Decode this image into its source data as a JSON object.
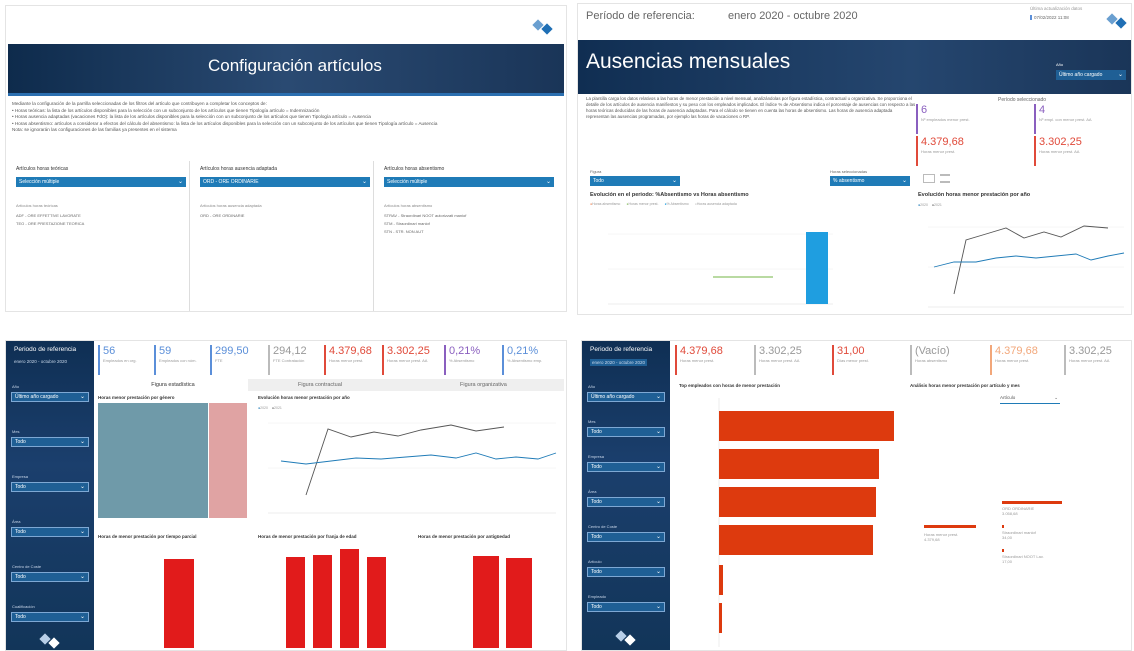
{
  "tl": {
    "title": "Configuración artículos",
    "desc": [
      "Mediante la configuración de la parrilla seleccionadas de los filtros del artículo que contribuyen a completar los conceptos de:",
      "• Horas teóricas: la lista de los artículos disponibles para la selección con un subconjunto de los artículos que tienen Tipología artículo = Indemnización",
      "• Horas ausencia adaptadas (vacaciones FdO): la lista de los artículos disponibles para la selección con un subconjunto de los artículos que tienen Tipología artículo = Ausencia",
      "• Horas absentismo: artículos a considerar a efectos del cálculo del absentismo: la lista de los artículos disponibles para la selección con un subconjunto de los artículos que tienen Tipología artículo = Ausencia",
      "Nota: se ignorarán las configuraciones de las familias ya presentes en el sistema"
    ],
    "cols": [
      {
        "head": "Artículos horas teóricas",
        "dd": "Selección múltiple",
        "sub": "Artículos horas teóricas",
        "items": [
          "ADF - ORE EFFETTIVE LAVORATE",
          "TEO - ORE PRESTAZIONE TEORICA"
        ]
      },
      {
        "head": "Artículos horas ausencia adaptada",
        "dd": "ORD - ORE ORDINARIE",
        "sub": "Artículos horas ausencia adaptada",
        "items": [
          "ORD - ORE ORDINARIE"
        ]
      },
      {
        "head": "Artículos horas absentismo",
        "dd": "Selección múltiple",
        "sub": "Artículos horas absentismo",
        "items": [
          "STRAV - Straordinari NOOT autorizzati maniof",
          "STM - Straordinari maniof",
          "STN - STR. NON AUT"
        ]
      }
    ]
  },
  "tr": {
    "ref_label": "Período de referencia:",
    "ref_value": "enero 2020 - octubre 2020",
    "update_label": "Última actualización datos",
    "update_value": "07/02/2022 11:08",
    "title": "Ausencias mensuales",
    "year_label": "Año",
    "year_value": "Último año cargado",
    "desc": "La plantilla carga los datos relativos a las horas de menor prestación a nivel mensual, analizándolas por figura estadística, contractual u organizativa. Se proporciona el detalle de los artículos de ausencia manifiestos y su peso con los empleados implicados. El índice % de Absentismo indica el porcentaje de ausencias con respecto a las horas teóricas deducidas de las horas de ausencia adaptadas. Para el cálculo se tienen en cuenta las horas de absentismo. Las horas de ausencia adaptada representan las ausencias programadas, por ejemplo las horas de vacaciones o RP.",
    "period_title": "Período seleccionado",
    "kpis": [
      {
        "v": "6",
        "l": "Nº empleados menor prest.",
        "c": "purple"
      },
      {
        "v": "4",
        "l": "Nº empl. con menor prest. AA",
        "c": "purple"
      },
      {
        "v": "4.379,68",
        "l": "Horas menor prest.",
        "c": "red"
      },
      {
        "v": "3.302,25",
        "l": "Horas menor prest. AA",
        "c": "red"
      }
    ],
    "filter1": "Figura",
    "filter1_val": "Todo",
    "filter2": "Horas seleccionadas",
    "filter2_val": "% absentismo",
    "chart1_title": "Evolución en el periodo: %Absentismo vs Horas absentismo",
    "chart1_legend": [
      "Horas absentismo",
      "Horas menor prest.",
      "% Absentismo",
      "Horas ausencia adaptada"
    ],
    "chart2_title": "Evolución horas menor prestación por año",
    "chart2_legend": [
      "2020",
      "2021"
    ]
  },
  "bl": {
    "ref_label": "Periodo de referencia",
    "ref_value": "enero 2020 - octubre 2020",
    "filters": [
      {
        "l": "Año",
        "v": "Último año cargado"
      },
      {
        "l": "Mes",
        "v": "Todo"
      },
      {
        "l": "Empresa",
        "v": "Todo"
      },
      {
        "l": "Área",
        "v": "Todo"
      },
      {
        "l": "Centro de Coste",
        "v": "Todo"
      },
      {
        "l": "Cualificación",
        "v": "Todo"
      }
    ],
    "kpis": [
      {
        "v": "56",
        "l": "Empleados en org.",
        "c": "blue"
      },
      {
        "v": "59",
        "l": "Empleados con nóm.",
        "c": "blue"
      },
      {
        "v": "299,50",
        "l": "FTE",
        "c": "blue"
      },
      {
        "v": "294,12",
        "l": "FTE Contratación",
        "c": "gray"
      },
      {
        "v": "4.379,68",
        "l": "Horas menor prest.",
        "c": "red"
      },
      {
        "v": "3.302,25",
        "l": "Horas menor prest. AA",
        "c": "red"
      },
      {
        "v": "0,21%",
        "l": "% Absentismo",
        "c": "purple"
      },
      {
        "v": "0,21%",
        "l": "% Absentismo emp.",
        "c": "blue"
      }
    ],
    "tabs": [
      "Figura estadística",
      "Figura contractual",
      "Figura organizativa"
    ],
    "c1_title": "Horas menor prestación por género",
    "c2_title": "Evolución horas menor prestación por año",
    "c3_title": "Horas de menor prestación por tiempo parcial",
    "c4_title": "Horas de menor prestación por franja de edad",
    "c5_title": "Horas de menor prestación por antigüedad",
    "c2_legend": [
      "2020",
      "2021"
    ]
  },
  "br": {
    "ref_label": "Periodo de referencia",
    "ref_value": "enero 2020 - octubre 2020",
    "filters": [
      {
        "l": "Año",
        "v": "Último año cargado"
      },
      {
        "l": "Mes",
        "v": "Todo"
      },
      {
        "l": "Empresa",
        "v": "Todo"
      },
      {
        "l": "Área",
        "v": "Todo"
      },
      {
        "l": "Centro de Coste",
        "v": "Todo"
      },
      {
        "l": "Artículo",
        "v": "Todo"
      },
      {
        "l": "Empleado",
        "v": "Todo"
      }
    ],
    "kpis": [
      {
        "v": "4.379,68",
        "l": "Horas menor prest.",
        "c": "red"
      },
      {
        "v": "3.302,25",
        "l": "Horas menor prest. AA",
        "c": "gray"
      },
      {
        "v": "31,00",
        "l": "Días menor prest.",
        "c": "red"
      },
      {
        "v": "(Vacío)",
        "l": "Horas absentismo",
        "c": "gray"
      },
      {
        "v": "4.379,68",
        "l": "Horas menor prest.",
        "c": "orange"
      },
      {
        "v": "3.302,25",
        "l": "Horas menor prest. AA",
        "c": "gray"
      }
    ],
    "c1_title": "Top empleados con horas de menor prestación",
    "c2_title": "Análisis horas menor prestación por artículo y mes",
    "c2_dd": "Artículo",
    "tree_root": "Horas menor prest.",
    "tree_root_v": "4.379,68",
    "tree": [
      {
        "l": "ORD ORDINARIE",
        "v": "3.058,68"
      },
      {
        "l": "Straordinari maniof",
        "v": "34,00"
      },
      {
        "l": "Straordinari NOOT Lav.",
        "v": "17,00"
      }
    ]
  }
}
